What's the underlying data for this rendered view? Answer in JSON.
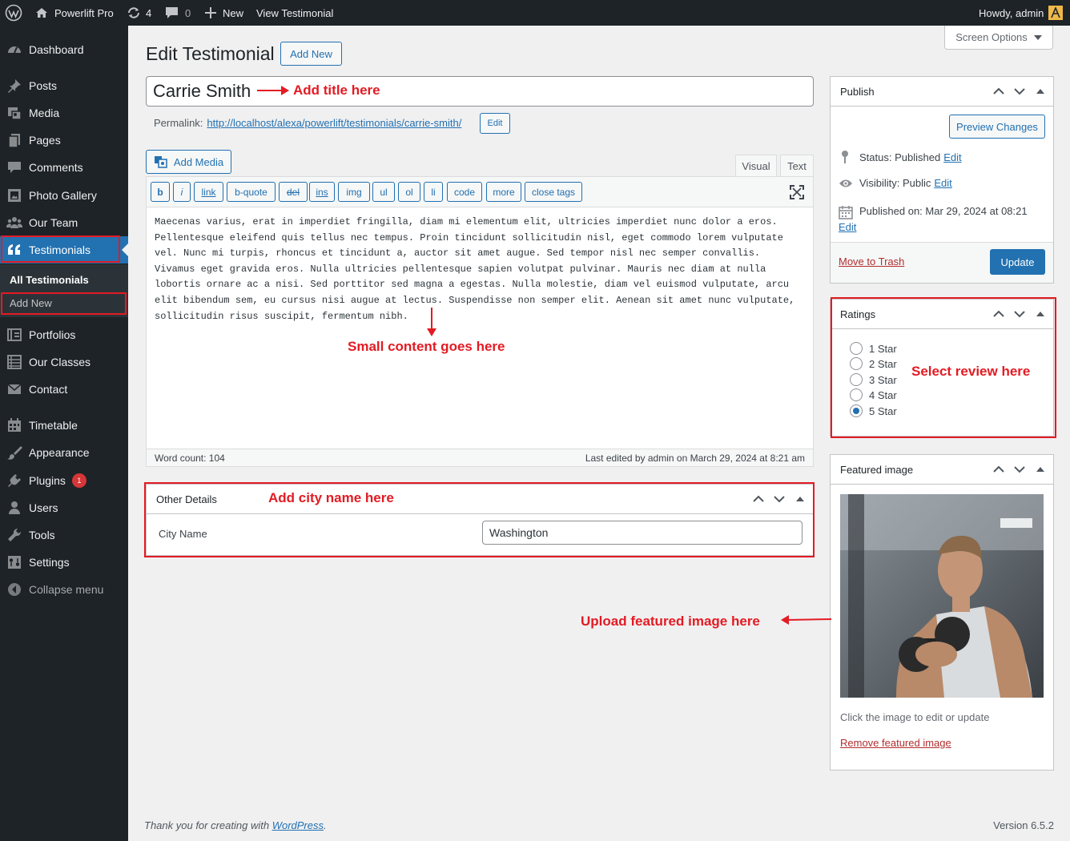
{
  "adminbar": {
    "site_name": "Powerlift Pro",
    "updates_count": "4",
    "comments_count": "0",
    "new_label": "New",
    "view_label": "View Testimonial",
    "howdy": "Howdy, admin"
  },
  "sidebar": {
    "items": [
      {
        "label": "Dashboard",
        "icon": "dashboard-icon"
      },
      {
        "label": "Posts",
        "icon": "pin-icon"
      },
      {
        "label": "Media",
        "icon": "media-icon"
      },
      {
        "label": "Pages",
        "icon": "pages-icon"
      },
      {
        "label": "Comments",
        "icon": "comment-icon"
      },
      {
        "label": "Photo Gallery",
        "icon": "gallery-icon"
      },
      {
        "label": "Our Team",
        "icon": "team-icon"
      },
      {
        "label": "Testimonials",
        "icon": "quote-icon"
      },
      {
        "label": "Portfolios",
        "icon": "portfolio-icon"
      },
      {
        "label": "Our Classes",
        "icon": "list-icon"
      },
      {
        "label": "Contact",
        "icon": "mail-icon"
      },
      {
        "label": "Timetable",
        "icon": "calendar-icon"
      },
      {
        "label": "Appearance",
        "icon": "brush-icon"
      },
      {
        "label": "Plugins",
        "icon": "plugin-icon"
      },
      {
        "label": "Users",
        "icon": "user-icon"
      },
      {
        "label": "Tools",
        "icon": "wrench-icon"
      },
      {
        "label": "Settings",
        "icon": "settings-icon"
      },
      {
        "label": "Collapse menu",
        "icon": "collapse-icon"
      }
    ],
    "plugins_badge": "1",
    "submenu": {
      "all": "All Testimonials",
      "add_new": "Add New"
    }
  },
  "screen_options": "Screen Options",
  "page": {
    "title": "Edit Testimonial",
    "add_new": "Add New",
    "post_title": "Carrie Smith",
    "permalink_label": "Permalink:",
    "permalink_url": "http://localhost/alexa/powerlift/testimonials/carrie-smith/",
    "permalink_edit": "Edit"
  },
  "editor": {
    "add_media": "Add Media",
    "tab_visual": "Visual",
    "tab_text": "Text",
    "quicktags": [
      "b",
      "i",
      "link",
      "b-quote",
      "del",
      "ins",
      "img",
      "ul",
      "ol",
      "li",
      "code",
      "more",
      "close tags"
    ],
    "content": "Maecenas varius, erat in imperdiet fringilla, diam mi elementum elit, ultricies imperdiet nunc dolor a eros. Pellentesque eleifend quis tellus nec tempus. Proin tincidunt sollicitudin nisl, eget commodo lorem vulputate vel. Nunc mi turpis, rhoncus et tincidunt a, auctor sit amet augue. Sed tempor nisl nec semper convallis. Vivamus eget gravida eros. Nulla ultricies pellentesque sapien volutpat pulvinar. Mauris nec diam at nulla lobortis ornare ac a nisi. Sed porttitor sed magna a egestas. Nulla molestie, diam vel euismod vulputate, arcu elit bibendum sem, eu cursus nisi augue at lectus. Suspendisse non semper elit. Aenean sit amet nunc vulputate, sollicitudin risus suscipit, fermentum nibh.",
    "word_count": "Word count: 104",
    "last_edited": "Last edited by admin on March 29, 2024 at 8:21 am"
  },
  "other_details": {
    "title": "Other Details",
    "city_label": "City Name",
    "city_value": "Washington"
  },
  "publish": {
    "title": "Publish",
    "preview": "Preview Changes",
    "status": "Status: ",
    "status_value": "Published",
    "visibility": "Visibility: ",
    "visibility_value": "Public",
    "published_on": "Published on: ",
    "published_value": "Mar 29, 2024 at 08:21",
    "edit": "Edit",
    "trash": "Move to Trash",
    "update": "Update"
  },
  "ratings": {
    "title": "Ratings",
    "options": [
      "1 Star",
      "2 Star",
      "3 Star",
      "4 Star",
      "5 Star"
    ],
    "selected": "5 Star"
  },
  "featured": {
    "title": "Featured image",
    "hint": "Click the image to edit or update",
    "remove": "Remove featured image"
  },
  "annotations": {
    "title": "Add title here",
    "content": "Small content goes here",
    "city": "Add city name here",
    "review": "Select review here",
    "image": "Upload featured image here"
  },
  "footer": {
    "thanks": "Thank you for creating with ",
    "wp_link": "WordPress",
    "version": "Version 6.5.2"
  },
  "colors": {
    "accent": "#2271b1",
    "annotation": "#e31b23",
    "sidebar": "#1d2327"
  }
}
